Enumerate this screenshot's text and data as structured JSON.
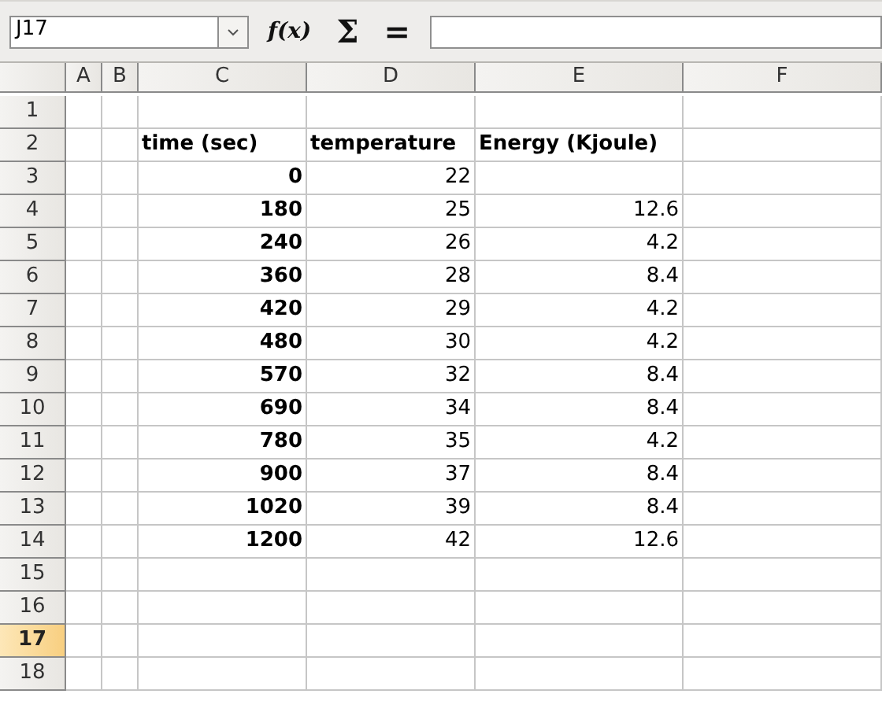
{
  "formula_bar": {
    "name_box": "J17",
    "buttons": [
      "f(x)",
      "Σ",
      "="
    ]
  },
  "columns": [
    "A",
    "B",
    "C",
    "D",
    "E",
    "F"
  ],
  "rows": [
    {
      "label": "1",
      "selected": false,
      "cells": [
        "",
        "",
        "",
        "",
        "",
        ""
      ]
    },
    {
      "label": "2",
      "selected": false,
      "cells": [
        "",
        "",
        "time (sec)",
        "temperature",
        "Energy (Kjoule)",
        ""
      ]
    },
    {
      "label": "3",
      "selected": false,
      "cells": [
        "",
        "",
        "0",
        "22",
        "",
        ""
      ]
    },
    {
      "label": "4",
      "selected": false,
      "cells": [
        "",
        "",
        "180",
        "25",
        "12.6",
        ""
      ]
    },
    {
      "label": "5",
      "selected": false,
      "cells": [
        "",
        "",
        "240",
        "26",
        "4.2",
        ""
      ]
    },
    {
      "label": "6",
      "selected": false,
      "cells": [
        "",
        "",
        "360",
        "28",
        "8.4",
        ""
      ]
    },
    {
      "label": "7",
      "selected": false,
      "cells": [
        "",
        "",
        "420",
        "29",
        "4.2",
        ""
      ]
    },
    {
      "label": "8",
      "selected": false,
      "cells": [
        "",
        "",
        "480",
        "30",
        "4.2",
        ""
      ]
    },
    {
      "label": "9",
      "selected": false,
      "cells": [
        "",
        "",
        "570",
        "32",
        "8.4",
        ""
      ]
    },
    {
      "label": "10",
      "selected": false,
      "cells": [
        "",
        "",
        "690",
        "34",
        "8.4",
        ""
      ]
    },
    {
      "label": "11",
      "selected": false,
      "cells": [
        "",
        "",
        "780",
        "35",
        "4.2",
        ""
      ]
    },
    {
      "label": "12",
      "selected": false,
      "cells": [
        "",
        "",
        "900",
        "37",
        "8.4",
        ""
      ]
    },
    {
      "label": "13",
      "selected": false,
      "cells": [
        "",
        "",
        "1020",
        "39",
        "8.4",
        ""
      ]
    },
    {
      "label": "14",
      "selected": false,
      "cells": [
        "",
        "",
        "1200",
        "42",
        "12.6",
        ""
      ]
    },
    {
      "label": "15",
      "selected": false,
      "cells": [
        "",
        "",
        "",
        "",
        "",
        ""
      ]
    },
    {
      "label": "16",
      "selected": false,
      "cells": [
        "",
        "",
        "",
        "",
        "",
        ""
      ]
    },
    {
      "label": "17",
      "selected": true,
      "cells": [
        "",
        "",
        "",
        "",
        "",
        ""
      ]
    },
    {
      "label": "18",
      "selected": false,
      "cells": [
        "",
        "",
        "",
        "",
        "",
        ""
      ]
    }
  ]
}
